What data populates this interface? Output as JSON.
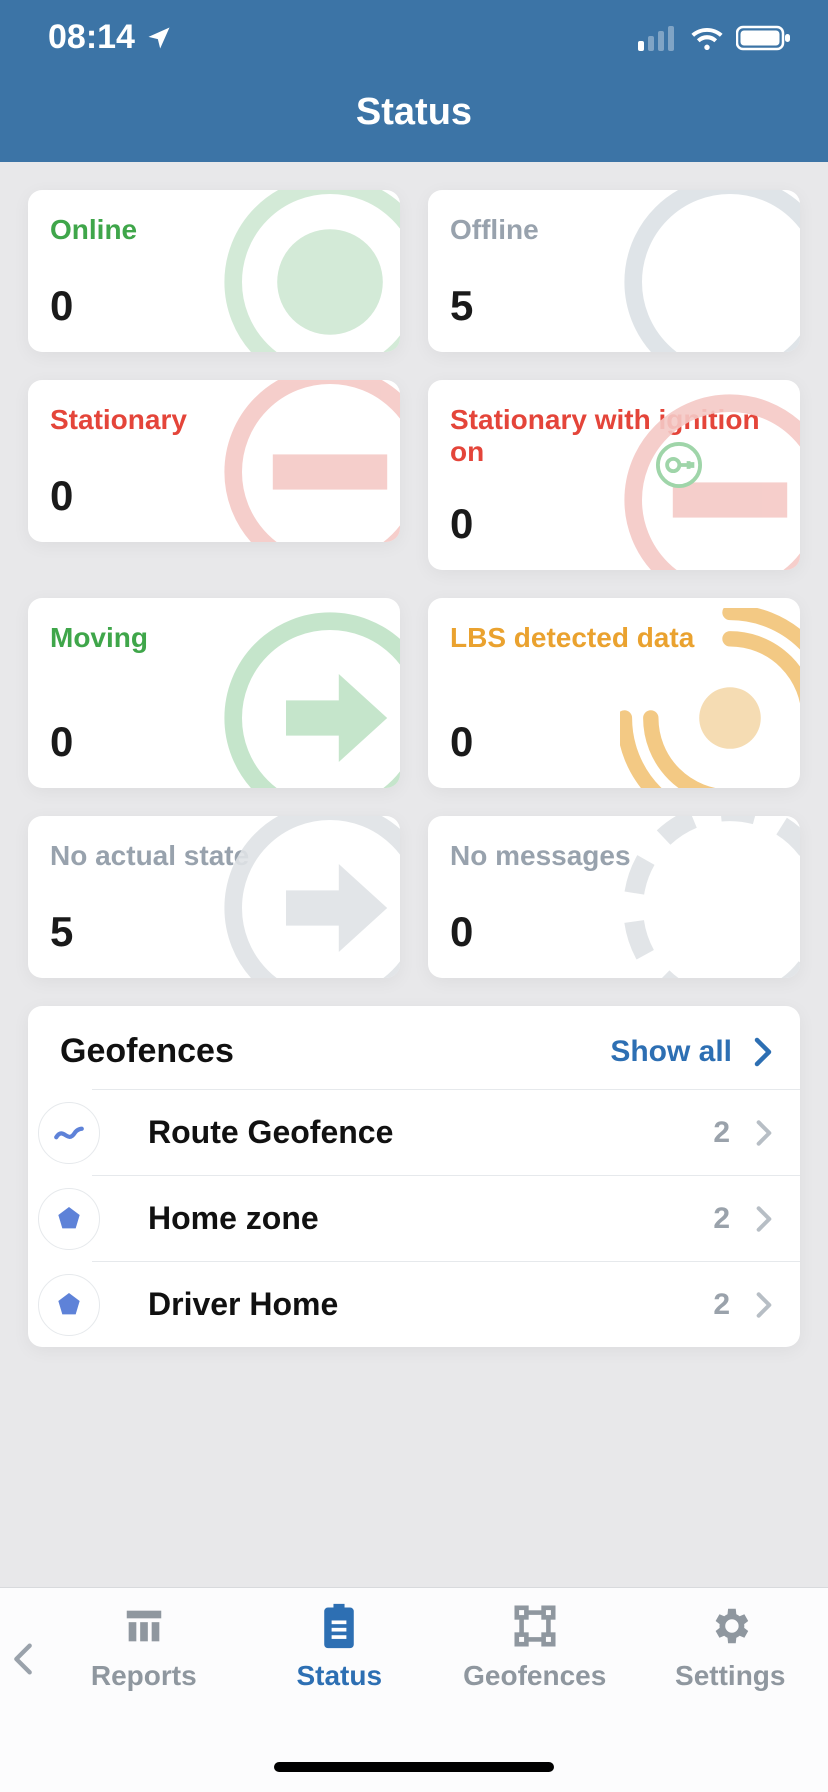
{
  "statusbar": {
    "time": "08:14"
  },
  "header": {
    "title": "Status"
  },
  "cards": [
    {
      "label": "Online",
      "value": "0",
      "colorClass": "c-green"
    },
    {
      "label": "Offline",
      "value": "5",
      "colorClass": "c-gray"
    },
    {
      "label": "Stationary",
      "value": "0",
      "colorClass": "c-red"
    },
    {
      "label": "Stationary with ignition on",
      "value": "0",
      "colorClass": "c-red"
    },
    {
      "label": "Moving",
      "value": "0",
      "colorClass": "c-green"
    },
    {
      "label": "LBS detected data",
      "value": "0",
      "colorClass": "c-orange"
    },
    {
      "label": "No actual state",
      "value": "5",
      "colorClass": "c-gray"
    },
    {
      "label": "No messages",
      "value": "0",
      "colorClass": "c-gray"
    }
  ],
  "geofences": {
    "title": "Geofences",
    "showAll": "Show all",
    "items": [
      {
        "name": "Route Geofence",
        "count": "2",
        "iconColor": "#5e82d8",
        "shape": "route"
      },
      {
        "name": "Home zone",
        "count": "2",
        "iconColor": "#5e82d8",
        "shape": "polygon"
      },
      {
        "name": "Driver Home",
        "count": "2",
        "iconColor": "#5e82d8",
        "shape": "polygon"
      }
    ]
  },
  "tabs": [
    {
      "label": "Reports",
      "active": false
    },
    {
      "label": "Status",
      "active": true
    },
    {
      "label": "Geofences",
      "active": false
    },
    {
      "label": "Settings",
      "active": false
    }
  ],
  "colors": {
    "headerBg": "#3c74a6",
    "accent": "#2d6fb3"
  }
}
